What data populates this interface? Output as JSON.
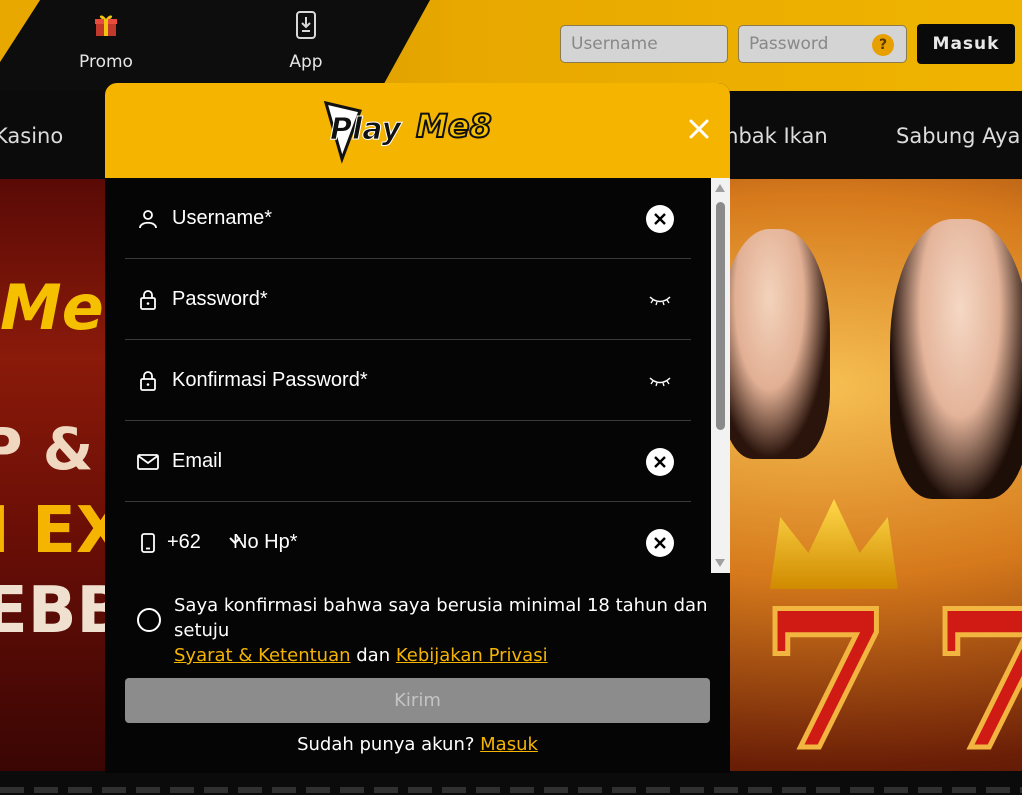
{
  "header": {
    "nav": [
      {
        "label": "Promo",
        "icon": "gift-icon"
      },
      {
        "label": "App",
        "icon": "mobile-download-icon"
      }
    ],
    "username_placeholder": "Username",
    "password_placeholder": "Password",
    "help_glyph": "?",
    "login_label": "Masuk"
  },
  "categories": [
    "Kasino",
    "mbak Ikan",
    "Sabung Ayam"
  ],
  "banner": {
    "brand_partial": "Me",
    "line1": "P & P",
    "line2": "I EX",
    "line3": "EBB",
    "seven": "7"
  },
  "modal": {
    "logo_play": "Play",
    "logo_me8": "Me8",
    "fields": {
      "username": "Username*",
      "password": "Password*",
      "confirm_password": "Konfirmasi Password*",
      "email": "Email",
      "country_code": "+62",
      "phone": "No Hp*"
    },
    "agree_prefix": "Saya konfirmasi bahwa saya berusia minimal 18 tahun dan setuju",
    "terms_link": "Syarat & Ketentuan",
    "and_text": "dan",
    "privacy_link": "Kebijakan Privasi",
    "submit_label": "Kirim",
    "already_text": "Sudah punya akun?",
    "login_link": "Masuk"
  },
  "colors": {
    "accent": "#f5b400",
    "modal_bg": "#050505",
    "submit_disabled": "#8c8c8c"
  }
}
